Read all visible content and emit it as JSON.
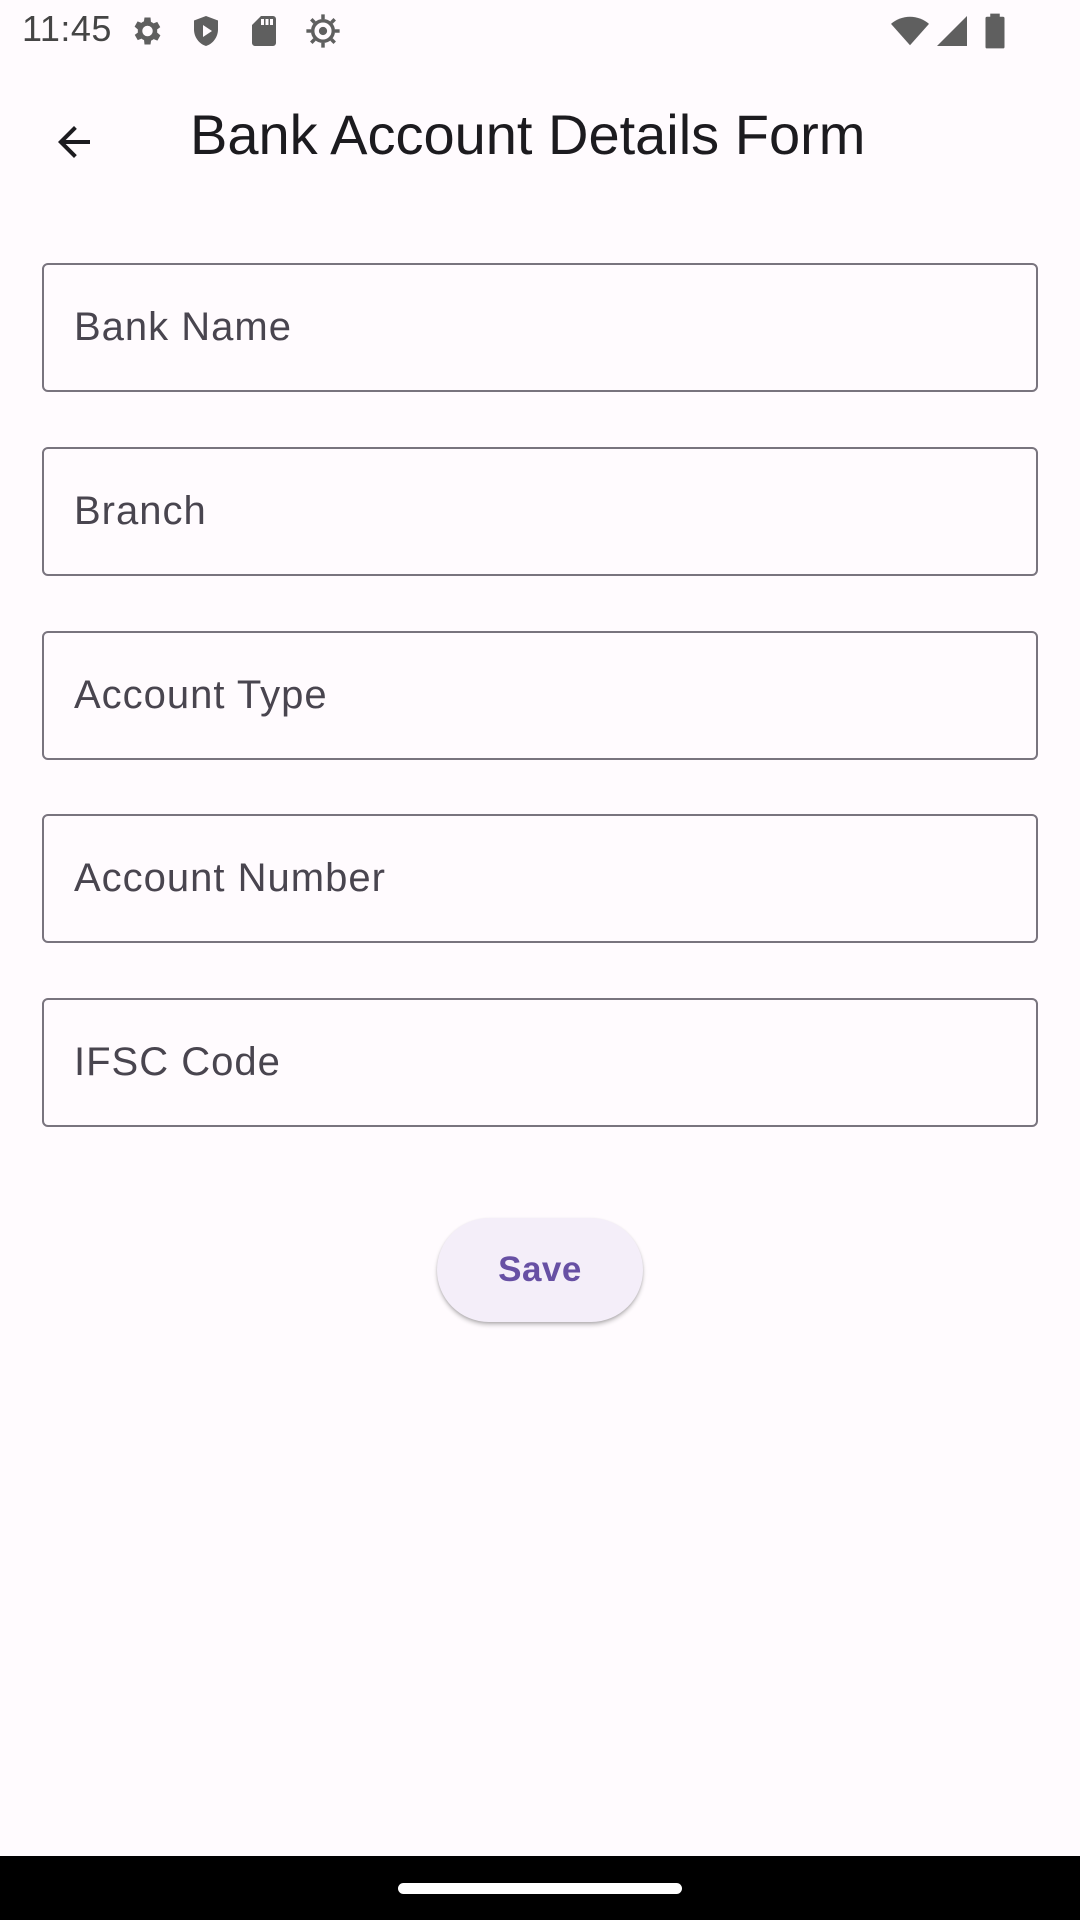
{
  "status_bar": {
    "time": "11:45",
    "left_icons": [
      "gear-icon",
      "shield-play-icon",
      "sd-card-icon",
      "sun-settings-icon"
    ],
    "right_icons": [
      "wifi-icon",
      "cell-signal-icon",
      "battery-icon"
    ]
  },
  "app_bar": {
    "title": "Bank Account Details Form",
    "back_icon": "arrow-back-icon"
  },
  "form": {
    "fields": [
      {
        "label": "Bank Name",
        "value": ""
      },
      {
        "label": "Branch",
        "value": ""
      },
      {
        "label": "Account Type",
        "value": ""
      },
      {
        "label": "Account Number",
        "value": ""
      },
      {
        "label": "IFSC Code",
        "value": ""
      }
    ],
    "save_label": "Save"
  },
  "colors": {
    "background": "#fffbfe",
    "outline": "#79747e",
    "label": "#49454f",
    "accent": "#6750a4",
    "button_surface": "#f4eef9"
  }
}
